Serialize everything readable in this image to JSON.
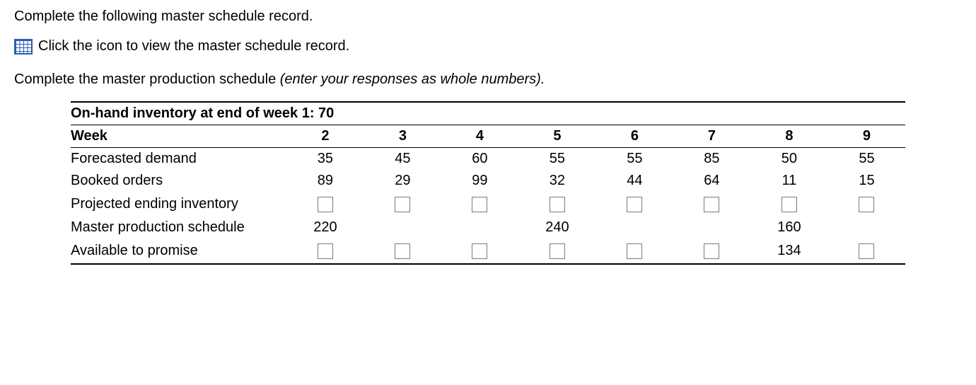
{
  "intro_text": "Complete the following master schedule record.",
  "icon_line_text": "Click the icon to view the master schedule record.",
  "instruction_prefix": "Complete the master production schedule ",
  "instruction_italic": "(enter your responses as whole numbers).",
  "header_inventory": "On-hand inventory at end of week 1: 70",
  "row_labels": {
    "week": "Week",
    "forecast": "Forecasted demand",
    "booked": "Booked orders",
    "pei": "Projected ending inventory",
    "mps": "Master production schedule",
    "atp": "Available to promise"
  },
  "chart_data": {
    "type": "table",
    "title": "Master schedule record",
    "weeks": [
      2,
      3,
      4,
      5,
      6,
      7,
      8,
      9
    ],
    "series": [
      {
        "name": "Forecasted demand",
        "values": [
          35,
          45,
          60,
          55,
          55,
          85,
          50,
          55
        ]
      },
      {
        "name": "Booked orders",
        "values": [
          89,
          29,
          99,
          32,
          44,
          64,
          11,
          15
        ]
      },
      {
        "name": "Projected ending inventory",
        "values": [
          null,
          null,
          null,
          null,
          null,
          null,
          null,
          null
        ],
        "input": [
          true,
          true,
          true,
          true,
          true,
          true,
          true,
          true
        ]
      },
      {
        "name": "Master production schedule",
        "values": [
          220,
          null,
          null,
          240,
          null,
          null,
          160,
          null
        ],
        "input": [
          false,
          false,
          false,
          false,
          false,
          false,
          false,
          false
        ]
      },
      {
        "name": "Available to promise",
        "values": [
          null,
          null,
          null,
          null,
          null,
          null,
          134,
          null
        ],
        "input": [
          true,
          true,
          true,
          true,
          true,
          true,
          false,
          true
        ]
      }
    ]
  }
}
